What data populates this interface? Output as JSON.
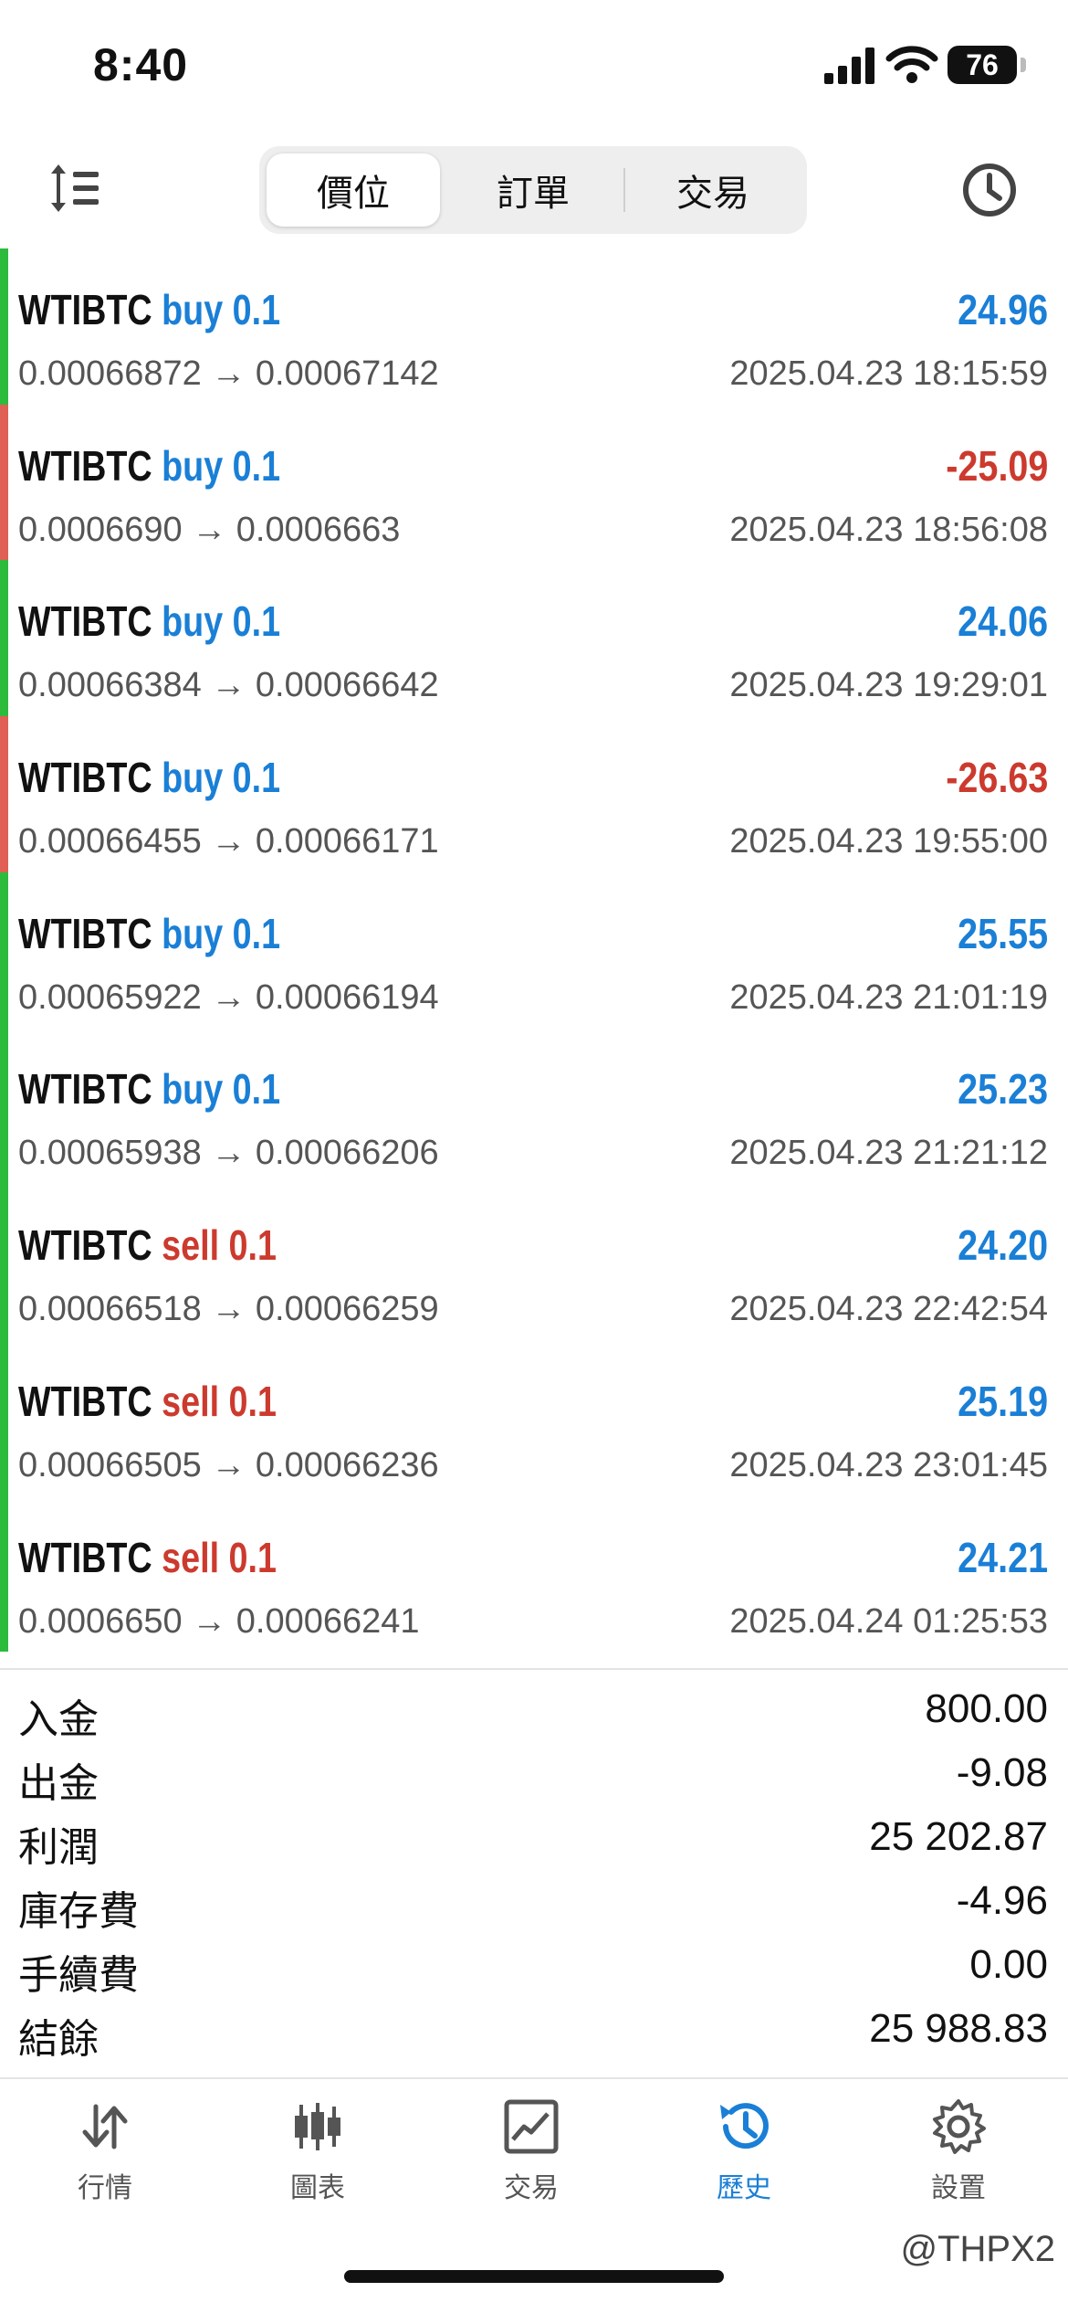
{
  "status_bar": {
    "time": "8:40",
    "battery": "76"
  },
  "segments": [
    {
      "label": "價位",
      "active": true
    },
    {
      "label": "訂單",
      "active": false
    },
    {
      "label": "交易",
      "active": false
    }
  ],
  "trades": [
    {
      "symbol": "WTIBTC",
      "action": "buy",
      "volume": "0.1",
      "open": "0.00066872",
      "close": "0.00067142",
      "datetime": "2025.04.23 18:15:59",
      "profit": "24.96",
      "positive": true
    },
    {
      "symbol": "WTIBTC",
      "action": "buy",
      "volume": "0.1",
      "open": "0.0006690",
      "close": "0.0006663",
      "datetime": "2025.04.23 18:56:08",
      "profit": "-25.09",
      "positive": false
    },
    {
      "symbol": "WTIBTC",
      "action": "buy",
      "volume": "0.1",
      "open": "0.00066384",
      "close": "0.00066642",
      "datetime": "2025.04.23 19:29:01",
      "profit": "24.06",
      "positive": true
    },
    {
      "symbol": "WTIBTC",
      "action": "buy",
      "volume": "0.1",
      "open": "0.00066455",
      "close": "0.00066171",
      "datetime": "2025.04.23 19:55:00",
      "profit": "-26.63",
      "positive": false
    },
    {
      "symbol": "WTIBTC",
      "action": "buy",
      "volume": "0.1",
      "open": "0.00065922",
      "close": "0.00066194",
      "datetime": "2025.04.23 21:01:19",
      "profit": "25.55",
      "positive": true
    },
    {
      "symbol": "WTIBTC",
      "action": "buy",
      "volume": "0.1",
      "open": "0.00065938",
      "close": "0.00066206",
      "datetime": "2025.04.23 21:21:12",
      "profit": "25.23",
      "positive": true
    },
    {
      "symbol": "WTIBTC",
      "action": "sell",
      "volume": "0.1",
      "open": "0.00066518",
      "close": "0.00066259",
      "datetime": "2025.04.23 22:42:54",
      "profit": "24.20",
      "positive": true
    },
    {
      "symbol": "WTIBTC",
      "action": "sell",
      "volume": "0.1",
      "open": "0.00066505",
      "close": "0.00066236",
      "datetime": "2025.04.23 23:01:45",
      "profit": "25.19",
      "positive": true
    },
    {
      "symbol": "WTIBTC",
      "action": "sell",
      "volume": "0.1",
      "open": "0.0006650",
      "close": "0.00066241",
      "datetime": "2025.04.24 01:25:53",
      "profit": "24.21",
      "positive": true
    }
  ],
  "summary": [
    {
      "label": "入金",
      "value": "800.00"
    },
    {
      "label": "出金",
      "value": "-9.08"
    },
    {
      "label": "利潤",
      "value": "25 202.87"
    },
    {
      "label": "庫存費",
      "value": "-4.96"
    },
    {
      "label": "手續費",
      "value": "0.00"
    },
    {
      "label": "結餘",
      "value": "25 988.83"
    }
  ],
  "tabs": [
    {
      "label": "行情",
      "icon": "arrows-updown-icon",
      "active": false
    },
    {
      "label": "圖表",
      "icon": "candlestick-icon",
      "active": false
    },
    {
      "label": "交易",
      "icon": "trade-chart-icon",
      "active": false
    },
    {
      "label": "歷史",
      "icon": "history-icon",
      "active": true
    },
    {
      "label": "設置",
      "icon": "gear-icon",
      "active": false
    }
  ],
  "watermark": "@THPX2",
  "colors": {
    "accent": "#1a7fd6",
    "loss": "#cc3a2e",
    "profit_bar": "#2dbb3c",
    "loss_bar": "#e06055"
  }
}
